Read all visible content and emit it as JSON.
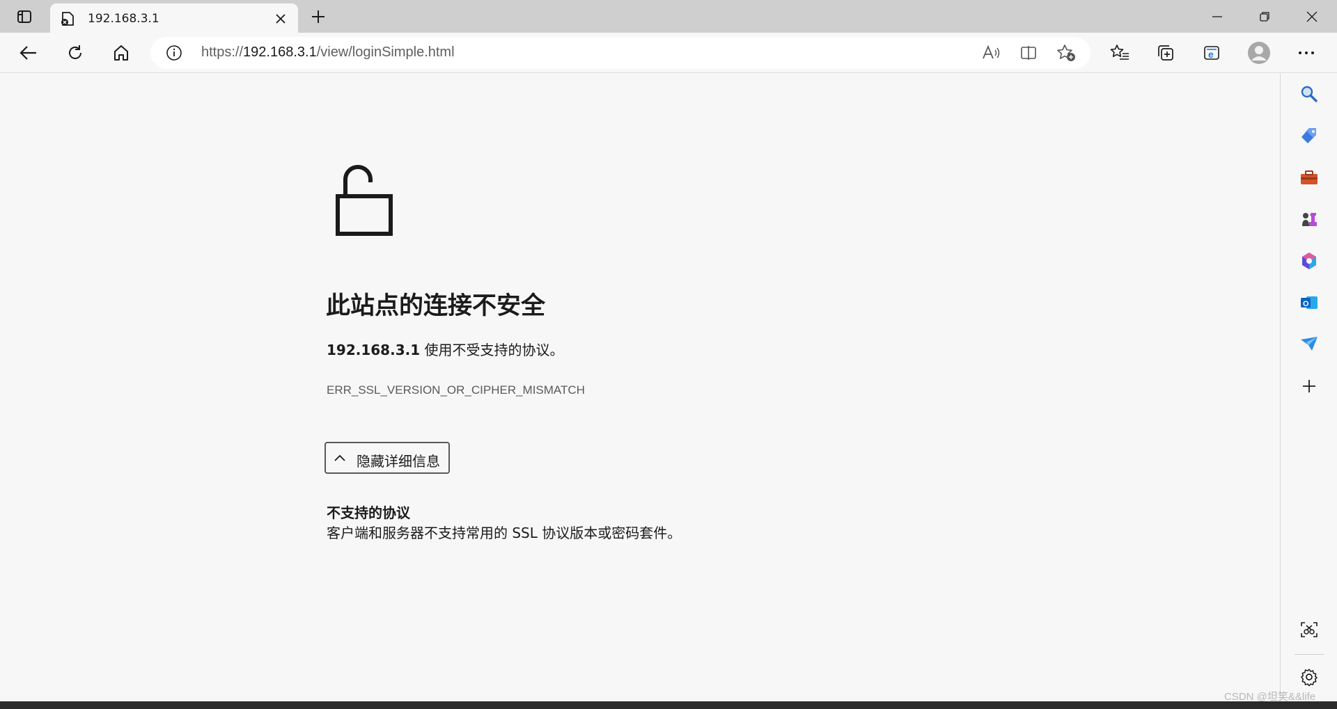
{
  "browser": {
    "tab": {
      "title": "192.168.3.1"
    },
    "address": {
      "url_prefix": "https://",
      "url_host": "192.168.3.1",
      "url_path": "/view/loginSimple.html"
    }
  },
  "page": {
    "heading": "此站点的连接不安全",
    "host": "192.168.3.1",
    "message": " 使用不受支持的协议。",
    "error_code": "ERR_SSL_VERSION_OR_CIPHER_MISMATCH",
    "details_button": "隐藏详细信息",
    "details_title": "不支持的协议",
    "details_desc": "客户端和服务器不支持常用的 SSL 协议版本或密码套件。"
  },
  "watermark": "CSDN @坦笑&&life",
  "icons": {
    "tab_actions": "tab-actions-icon",
    "favicon": "error-page-icon",
    "back": "back-arrow-icon",
    "refresh": "refresh-icon",
    "home": "home-icon",
    "info": "info-icon",
    "read_aloud": "read-aloud-icon",
    "split": "split-screen-icon",
    "fav_add": "star-add-icon",
    "favorites": "favorites-icon",
    "collections": "collections-icon",
    "ie_mode": "ie-mode-icon",
    "profile": "profile-icon",
    "more": "more-icon"
  },
  "colors": {
    "page_bg": "#f7f7f7",
    "titlebar_bg": "#cfcfcf",
    "text": "#1b1b1b",
    "muted": "#5a5a5a"
  }
}
